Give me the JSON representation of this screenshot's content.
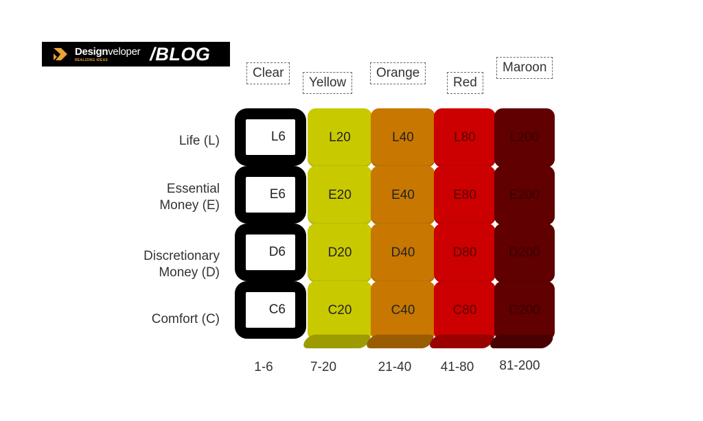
{
  "logo": {
    "brand_bold": "Design",
    "brand_thin": "veloper",
    "tagline": "REALIZING IDEAS",
    "section": "/BLOG"
  },
  "colors": {
    "clear": "#ffffff",
    "clear_border": "#000000",
    "yellow": "#c9c900",
    "yellow_shade": "#9c9c00",
    "orange": "#c87800",
    "orange_shade": "#9a5c00",
    "red": "#cc0000",
    "red_shade": "#9a0000",
    "maroon": "#600000",
    "maroon_shade": "#480000",
    "logo_accent": "#e8a437"
  },
  "columns": [
    {
      "key": "clear",
      "label": "Clear",
      "range": "1-6",
      "suffix": "6"
    },
    {
      "key": "yellow",
      "label": "Yellow",
      "range": "7-20",
      "suffix": "20"
    },
    {
      "key": "orange",
      "label": "Orange",
      "range": "21-40",
      "suffix": "40"
    },
    {
      "key": "red",
      "label": "Red",
      "range": "41-80",
      "suffix": "80"
    },
    {
      "key": "maroon",
      "label": "Maroon",
      "range": "81-200",
      "suffix": "200"
    }
  ],
  "rows": [
    {
      "label_line1": "Life (L)",
      "label_line2": "",
      "code": "L"
    },
    {
      "label_line1": "Essential",
      "label_line2": "Money (E)",
      "code": "E"
    },
    {
      "label_line1": "Discretionary",
      "label_line2": "Money (D)",
      "code": "D"
    },
    {
      "label_line1": "Comfort (C)",
      "label_line2": "",
      "code": "C"
    }
  ],
  "cells": [
    [
      "L6",
      "L20",
      "L40",
      "L80",
      "L200"
    ],
    [
      "E6",
      "E20",
      "E40",
      "E80",
      "E200"
    ],
    [
      "D6",
      "D20",
      "D40",
      "D80",
      "D200"
    ],
    [
      "C6",
      "C20",
      "C40",
      "C80",
      "C200"
    ]
  ]
}
